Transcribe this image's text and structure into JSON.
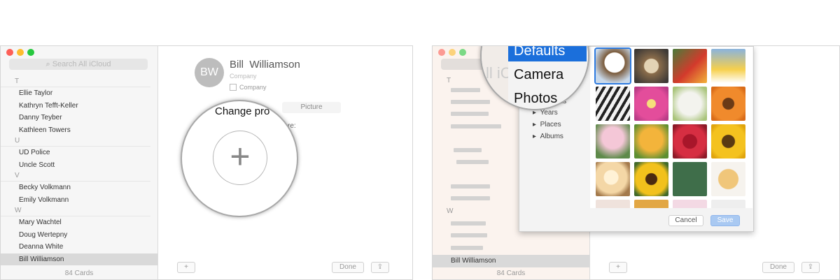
{
  "left": {
    "search_placeholder": "Search All iCloud",
    "groups": [
      {
        "letter": "T",
        "names": [
          "Ellie Taylor",
          "Kathryn Tefft-Keller",
          "Danny Teyber",
          "Kathleen Towers"
        ]
      },
      {
        "letter": "U",
        "names": [
          "UD Police",
          "Uncle Scott"
        ]
      },
      {
        "letter": "V",
        "names": [
          "Becky Volkmann",
          "Emily Volkmann"
        ]
      },
      {
        "letter": "W",
        "names": [
          "Mary Wachtel",
          "Doug Wertepny",
          "Deanna White",
          "Bill Williamson"
        ]
      }
    ],
    "card_count": "84 Cards",
    "contact": {
      "initials": "BW",
      "first": "Bill",
      "last": "Williamson",
      "company_placeholder": "Company",
      "company_checkbox": "Company"
    },
    "change_profile": "Change pro",
    "picture_tab": "Picture",
    "re_label": "re:",
    "plus_glyph": "+",
    "done": "Done",
    "add": "+",
    "share": "⇪"
  },
  "right": {
    "search_text": "ll iC",
    "selected_name": "Bill Williamson",
    "card_count": "84 Cards",
    "menu": {
      "defaults": "Defaults",
      "camera": "Camera",
      "photos": "Photos"
    },
    "sources": [
      "tions",
      "Years",
      "Places",
      "Albums"
    ],
    "cancel": "Cancel",
    "save": "Save",
    "done": "Done",
    "add": "+",
    "share": "⇪",
    "section_letters": [
      "T",
      "W"
    ]
  },
  "colors": {
    "close": "#fd5f57",
    "min": "#fdbc2e",
    "max": "#27c83f",
    "selection": "#1b6fdb",
    "save": "#a9c9f2"
  }
}
